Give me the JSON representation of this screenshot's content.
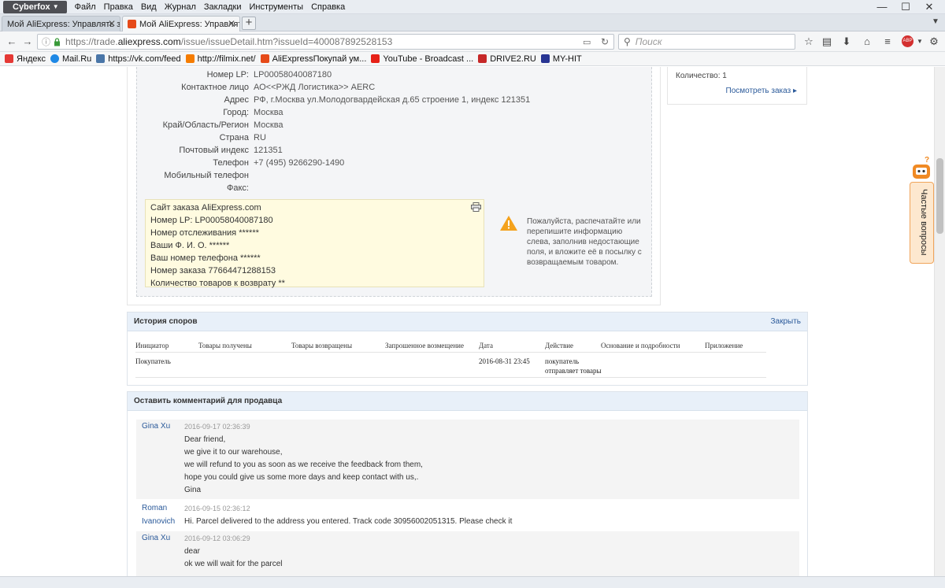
{
  "browser": {
    "app_name": "Cyberfox",
    "menu": [
      "Файл",
      "Правка",
      "Вид",
      "Журнал",
      "Закладки",
      "Инструменты",
      "Справка"
    ],
    "tabs": [
      {
        "title": "Мой AliExpress: Управлять заказ..."
      },
      {
        "title": "Мой AliExpress: Управлять зака..."
      }
    ],
    "url_prefix": "https://trade.",
    "url_domain": "aliexpress.com",
    "url_path": "/issue/issueDetail.htm?issueId=400087892528153",
    "search_placeholder": "Поиск",
    "bookmarks": [
      {
        "label": "Яндекс",
        "color": "#e53935"
      },
      {
        "label": "Mail.Ru",
        "color": "#1e88e5"
      },
      {
        "label": "https://vk.com/feed",
        "color": "#4a76a8"
      },
      {
        "label": "http://filmix.net/",
        "color": "#f57c00"
      },
      {
        "label": "AliExpressПокупай ум...",
        "color": "#e64a19"
      },
      {
        "label": "YouTube - Broadcast ...",
        "color": "#e62117"
      },
      {
        "label": "DRIVE2.RU",
        "color": "#c62828"
      },
      {
        "label": "MY-HIT",
        "color": "#283593"
      }
    ]
  },
  "address": {
    "rows": [
      {
        "label": "Номер LP:",
        "value": "LP00058040087180"
      },
      {
        "label": "Контактное лицо",
        "value": "АО<<РЖД Логистика>> AERC"
      },
      {
        "label": "Адрес",
        "value": "РФ, г.Москва ул.Молодогвардейская д.65 строение 1, индекс 121351"
      },
      {
        "label": "Город:",
        "value": "Москва"
      },
      {
        "label": "Край/Область/Регион",
        "value": "Москва"
      },
      {
        "label": "Страна",
        "value": "RU"
      },
      {
        "label": "Почтовый индекс",
        "value": "121351"
      },
      {
        "label": "Телефон",
        "value": "+7 (495) 9266290-1490"
      },
      {
        "label": "Мобильный телефон",
        "value": ""
      },
      {
        "label": "Факс:",
        "value": ""
      }
    ],
    "slip_lines": [
      "Сайт заказа AliExpress.com",
      "Номер LP: LP00058040087180",
      "Номер отслеживания ******",
      "Ваши Ф. И. О. ******",
      "Ваш номер телефона ******",
      "Номер заказа 77664471288153",
      "Количество товаров к возврату **"
    ],
    "warning_text": "Пожалуйста, распечатайте или перепишите информацию слева, заполнив недостающие поля, и вложите её в посылку с возвращаемым товаром."
  },
  "order_side": {
    "quantity": "Количество: 1",
    "view_order": "Посмотреть заказ"
  },
  "help_widget": {
    "label": "Частые вопросы"
  },
  "disputes": {
    "title": "История споров",
    "close_label": "Закрыть",
    "headers": [
      "Инициатор",
      "Товары получены",
      "Товары возвращены",
      "Запрошенное возмещение",
      "Дата",
      "Действие",
      "Основание и подробности",
      "Приложение"
    ],
    "row": {
      "initiator": "Покупатель",
      "received": "",
      "returned": "",
      "refund": "",
      "date": "2016-08-31 23:45",
      "action_1": "покупатель",
      "action_2": "отправляет товары",
      "reason": "",
      "attachment": ""
    }
  },
  "comments": {
    "title": "Оставить комментарий для продавца",
    "messages": [
      {
        "author": "Gina Xu",
        "date": "2016-09-17 02:36:39",
        "lines": [
          "Dear friend,",
          "we give it to our warehouse,",
          "we will refund to you as soon as we receive the feedback from them,",
          "hope you could give us some more days and keep contact with us,.",
          "Gina"
        ]
      },
      {
        "author": "Roman Ivanovich",
        "date": "2016-09-15 02:36:12",
        "lines": [
          "Hi. Parcel delivered to the address you entered. Track code 30956002051315. Please check it"
        ]
      },
      {
        "author": "Gina Xu",
        "date": "2016-09-12 03:06:29",
        "lines": [
          "dear",
          "ok we will wait for the parcel"
        ]
      }
    ]
  }
}
